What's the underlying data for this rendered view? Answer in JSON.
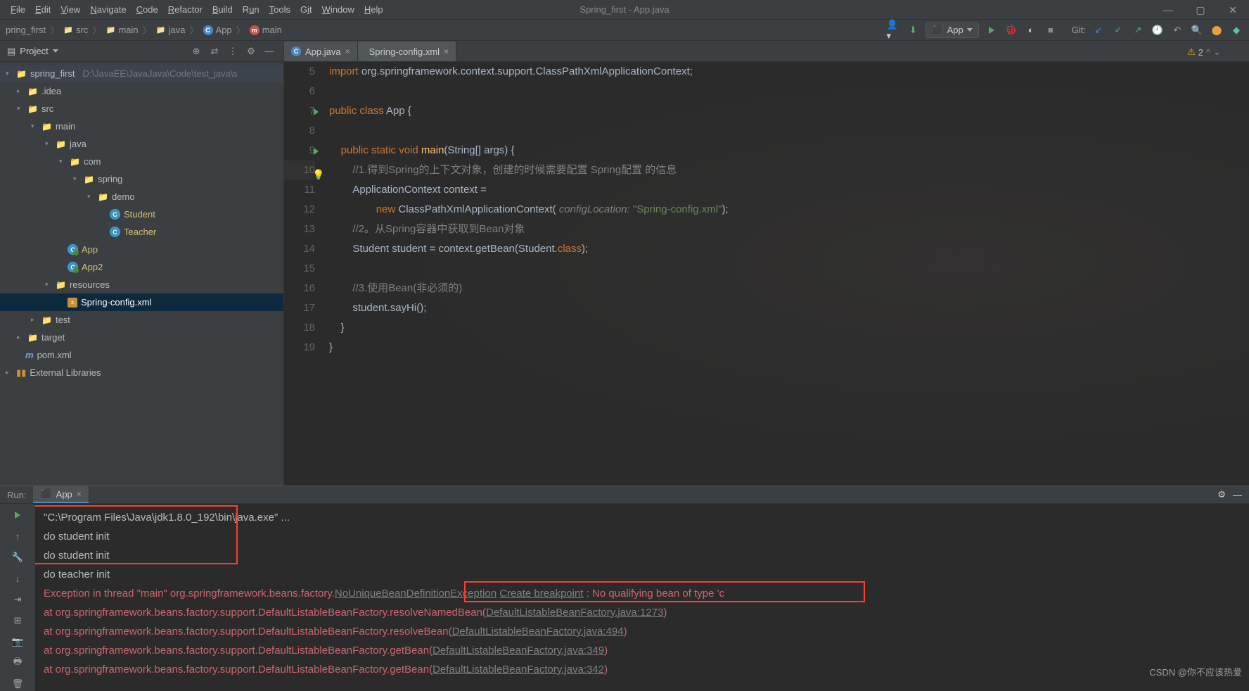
{
  "window": {
    "title": "Spring_first - App.java"
  },
  "menu": [
    "File",
    "Edit",
    "View",
    "Navigate",
    "Code",
    "Refactor",
    "Build",
    "Run",
    "Tools",
    "Git",
    "Window",
    "Help"
  ],
  "breadcrumbs": [
    "pring_first",
    "src",
    "main",
    "java",
    "App",
    "main"
  ],
  "runConfig": "App",
  "gitLabel": "Git:",
  "projectPanel": {
    "title": "Project"
  },
  "tree": {
    "root": {
      "name": "spring_first",
      "path": "D:\\JavaEE\\JavaJava\\Code\\test_java\\s"
    },
    "idea": ".idea",
    "src": "src",
    "mainDir": "main",
    "java": "java",
    "com": "com",
    "spring": "spring",
    "demo": "demo",
    "student": "Student",
    "teacher": "Teacher",
    "app": "App",
    "app2": "App2",
    "resources": "resources",
    "springcfg": "Spring-config.xml",
    "test": "test",
    "target": "target",
    "pom": "pom.xml",
    "extlib": "External Libraries"
  },
  "tabs": [
    {
      "label": "App.java",
      "icon": "class"
    },
    {
      "label": "Spring-config.xml",
      "icon": "xml"
    }
  ],
  "warnings": {
    "count": "2"
  },
  "code": {
    "l5": {
      "kw1": "import",
      "rest": " org.springframework.context.support.ClassPathXmlApplicationContext;"
    },
    "l7": {
      "kw": "public class",
      "cls": " App ",
      "brace": "{"
    },
    "l9": {
      "kw": "public static void",
      "fn": " main",
      "sig": "(String[] args) {"
    },
    "l10": "//1.得到Spring的上下文对象，创建的时候需要配置 Spring配置 的信息",
    "l11": "ApplicationContext context =",
    "l12": {
      "kw": "new",
      "cls": " ClassPathXmlApplicationContext(",
      "param": " configLocation: ",
      "str": "\"Spring-config.xml\"",
      "end": ");"
    },
    "l13": "//2。从Spring容器中获取到Bean对象",
    "l14": {
      "a": "Student student = context.getBean(Student.",
      "kw": "class",
      "b": ");"
    },
    "l16": "//3.使用Bean(非必须的)",
    "l17": "student.sayHi();"
  },
  "run": {
    "label": "Run:",
    "tab": "App",
    "cmd": "\"C:\\Program Files\\Java\\jdk1.8.0_192\\bin\\java.exe\" ...",
    "out1": "do student init",
    "out2": "do student init",
    "out3": "do teacher init",
    "exc_pre": "Exception in thread \"main\" org.springframework.beans.factory.",
    "exc_cls": "NoUniqueBeanDefinitionException",
    "exc_bp": "Create breakpoint",
    "exc_post": " : No qualifying bean of type 'c",
    "st1a": "at org.springframework.beans.factory.support.DefaultListableBeanFactory.resolveNamedBean(",
    "st1b": "DefaultListableBeanFactory.java:1273",
    "st2a": "at org.springframework.beans.factory.support.DefaultListableBeanFactory.resolveBean(",
    "st2b": "DefaultListableBeanFactory.java:494",
    "st3a": "at org.springframework.beans.factory.support.DefaultListableBeanFactory.getBean(",
    "st3b": "DefaultListableBeanFactory.java:349",
    "st4a": "at org.springframework.beans.factory.support.DefaultListableBeanFactory.getBean(",
    "st4b": "DefaultListableBeanFactory.java:342"
  },
  "watermark": "CSDN @你不应该热爱"
}
